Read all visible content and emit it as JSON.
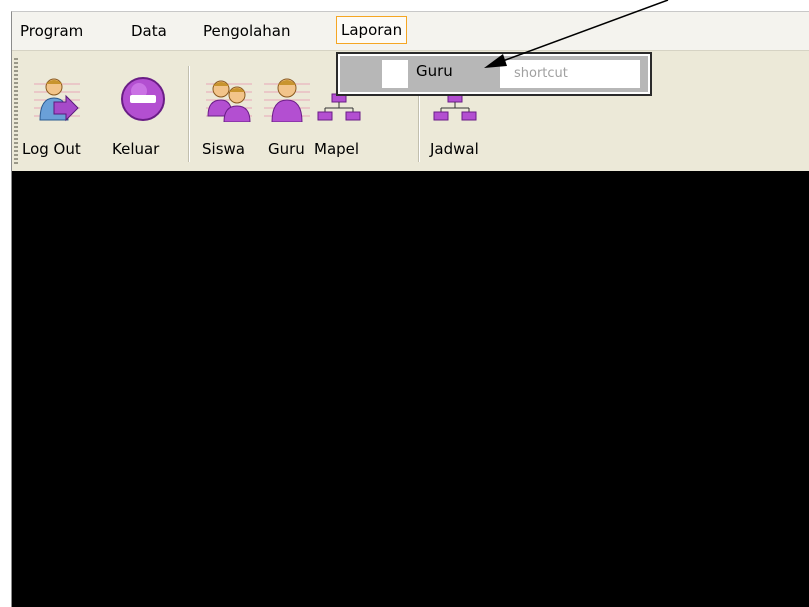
{
  "menubar": {
    "items": [
      {
        "label": "Program"
      },
      {
        "label": "Data"
      },
      {
        "label": "Pengolahan"
      },
      {
        "label": "Laporan"
      }
    ]
  },
  "toolbar": {
    "buttons": [
      {
        "label": "Log Out",
        "icon": "logout-user-icon"
      },
      {
        "label": "Keluar",
        "icon": "exit-no-entry-icon"
      },
      {
        "label": "Siswa",
        "icon": "students-icon"
      },
      {
        "label": "Guru",
        "icon": "teacher-icon"
      },
      {
        "label": "Mapel",
        "icon": "hierarchy-icon"
      },
      {
        "label": "Jadwal",
        "icon": "hierarchy-icon"
      }
    ]
  },
  "popup": {
    "item_label": "Guru",
    "shortcut_text": "shortcut"
  },
  "colors": {
    "menu_active_border": "#f5a623",
    "workspace": "#000000",
    "toolbar_bg": "#ece9d8",
    "icon_purple": "#a64ac9"
  }
}
